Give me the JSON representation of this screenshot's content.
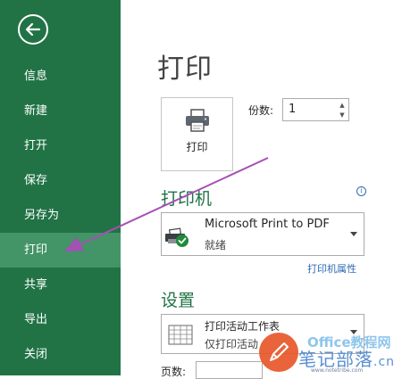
{
  "sidebar": {
    "items": [
      {
        "label": "信息"
      },
      {
        "label": "新建"
      },
      {
        "label": "打开"
      },
      {
        "label": "保存"
      },
      {
        "label": "另存为"
      },
      {
        "label": "打印",
        "active": true
      },
      {
        "label": "共享"
      },
      {
        "label": "导出"
      },
      {
        "label": "关闭"
      }
    ]
  },
  "main": {
    "title": "打印",
    "print_button_label": "打印",
    "copies": {
      "label": "份数:",
      "value": "1"
    },
    "printer_section": {
      "heading": "打印机",
      "printer_name": "Microsoft Print to PDF",
      "status": "就绪",
      "properties_link": "打印机属性"
    },
    "settings_section": {
      "heading": "设置",
      "option_main": "打印活动工作表",
      "option_sub": "仅打印活动",
      "pages_label": "页数:"
    }
  },
  "watermark": {
    "top_text": "Office教程网",
    "main_text": "笔记部落",
    "suffix": ".cn",
    "url": "www.notetribe.com"
  },
  "colors": {
    "sidebar_bg": "#217346",
    "sidebar_active": "#439467",
    "heading_green": "#217346",
    "link_blue": "#2f6bb3",
    "annotation_arrow": "#a64fb4"
  },
  "icons": [
    "back-arrow-icon",
    "printer-icon",
    "printer-ready-icon",
    "info-icon",
    "sheet-grid-icon",
    "dropdown-arrow-icon"
  ]
}
